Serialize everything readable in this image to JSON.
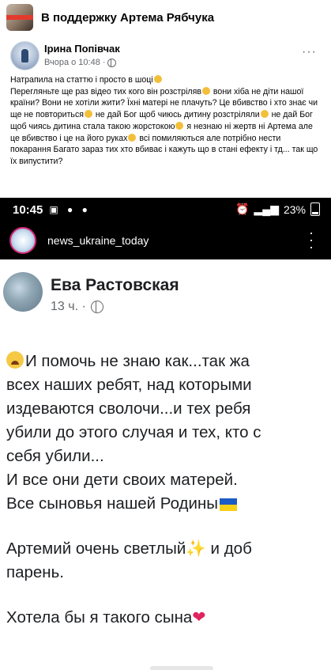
{
  "group": {
    "title": "В поддержку Артема Рябчука"
  },
  "post": {
    "author": "Ірина Попівчак",
    "time": "Вчора о 10:48",
    "more": "···",
    "text_lines": [
      "Натрапила на статтю і просто в шоці",
      "Перегляньте ще раз відео тих кого він розстріляв",
      " вони хіба не діти нашої країни? Вони не хотіли жити? Їхні матері не плачуть? Це вбивство і хто знає чи ще не повториться",
      " не дай Бог щоб чиюсь дитину розстріляли",
      " не дай Бог щоб чиясь дитина стала такою жорстокою",
      " я незнаю ні жертв ні Артема але це вбивство і це на його руках",
      " всі помиляються але потрібно нести покарання Багато зараз тих хто вбиває і кажуть що в стані ефекту і тд... так що їх випустити?"
    ]
  },
  "screenshot": {
    "status_time": "10:45",
    "status_battery": "23%",
    "ig_account": "news_ukraine_today",
    "fb_author": "Ева Растовская",
    "fb_time": "13 ч. ·",
    "lines": [
      "И помочь не знаю как...так жа",
      "всех наших ребят, над которыми",
      "издеваются сволочи...и тех ребя",
      "убили до этого случая и тех, кто с",
      "себя убили...",
      "И все они дети своих матерей.",
      "Все сыновья нашей Родины",
      "Артемий очень светлый",
      " и доб",
      "парень.",
      "Хотела бы я такого сына"
    ]
  },
  "colors": {
    "text": "#050505",
    "muted": "#65676b",
    "story_ring": "#d62976",
    "heart": "#e0245e",
    "flag_blue": "#1d5cc6",
    "flag_yellow": "#f7d117"
  }
}
